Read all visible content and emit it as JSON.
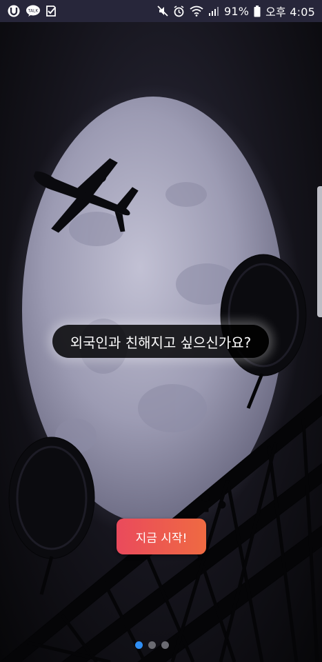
{
  "status_bar": {
    "battery_percent": "91%",
    "time": "오후 4:05",
    "icons_left": [
      "u-app-icon",
      "kakaotalk-icon",
      "check-icon"
    ],
    "icons_right": [
      "mute-icon",
      "alarm-icon",
      "wifi-icon",
      "signal-icon",
      "battery-icon"
    ],
    "kakao_label": "TALK"
  },
  "onboarding": {
    "caption": "외국인과 친해지고 싶으신가요?",
    "start_button": "지금 시작!",
    "page_count": 3,
    "active_page": 1
  },
  "colors": {
    "status_bar_bg": "#27263a",
    "button_gradient_start": "#ea4a5c",
    "button_gradient_end": "#ef6a42",
    "pager_active": "#2f8ef4",
    "pager_inactive": "#6b6b72"
  }
}
